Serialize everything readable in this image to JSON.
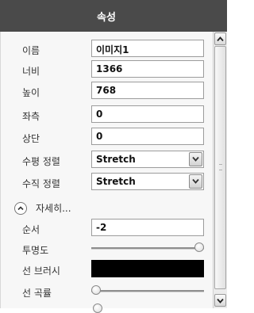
{
  "header": {
    "title": "속성"
  },
  "fields": {
    "name": {
      "label": "이름",
      "value": "이미지1"
    },
    "width": {
      "label": "너비",
      "value": "1366"
    },
    "height": {
      "label": "높이",
      "value": "768"
    },
    "left": {
      "label": "좌측",
      "value": "0"
    },
    "top": {
      "label": "상단",
      "value": "0"
    },
    "halign": {
      "label": "수평 정렬",
      "value": "Stretch"
    },
    "valign": {
      "label": "수직 정렬",
      "value": "Stretch"
    }
  },
  "more": {
    "label": "자세히..."
  },
  "advanced": {
    "order": {
      "label": "순서",
      "value": "-2"
    },
    "opacity": {
      "label": "투명도",
      "value": 1.0
    },
    "stroke_brush": {
      "label": "선 브러시",
      "color": "#000000"
    },
    "stroke_curve": {
      "label": "선 곡률",
      "value": 0.0
    }
  },
  "colors": {
    "header_bg": "#4a4a4a",
    "panel_bg": "#f7f7f7"
  }
}
